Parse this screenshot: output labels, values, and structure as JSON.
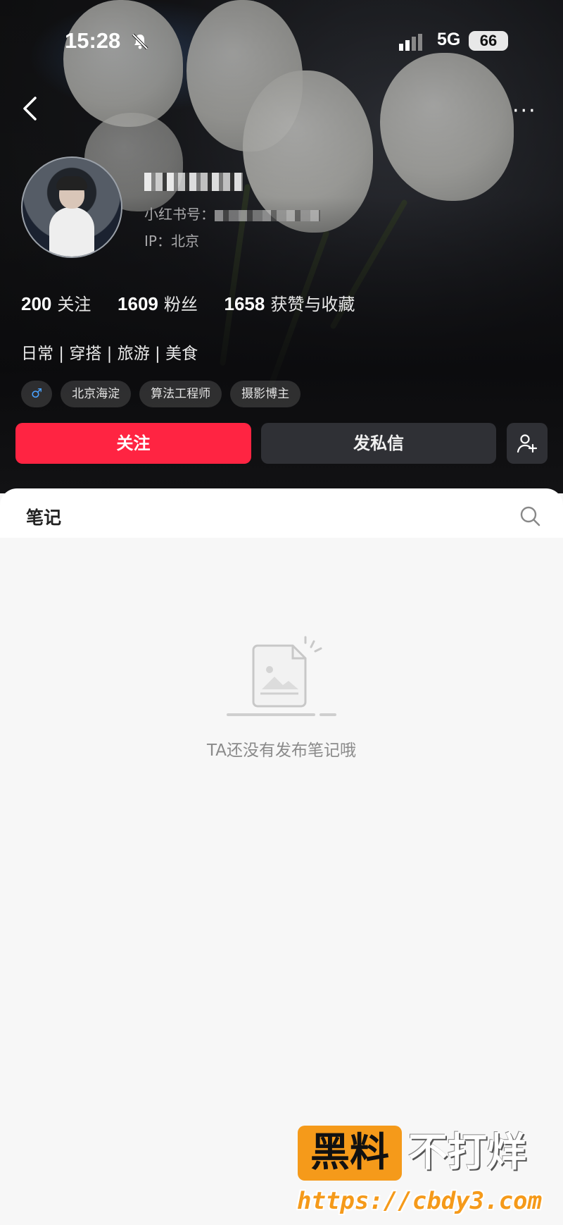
{
  "status_bar": {
    "time": "15:28",
    "network": "5G",
    "battery": "66"
  },
  "profile": {
    "red_id_label": "小红书号：",
    "ip_label": "IP：北京",
    "stats": [
      {
        "value": "200",
        "label": "关注"
      },
      {
        "value": "1609",
        "label": "粉丝"
      },
      {
        "value": "1658",
        "label": "获赞与收藏"
      }
    ],
    "bio": "日常 | 穿搭 | 旅游 | 美食",
    "gender_tag": "♂",
    "tags": [
      "北京海淀",
      "算法工程师",
      "摄影博主"
    ]
  },
  "actions": {
    "follow": "关注",
    "message": "发私信"
  },
  "notes": {
    "tab_label": "笔记",
    "empty_text": "TA还没有发布笔记哦"
  },
  "watermark": {
    "box": "黑料",
    "right": "不打烊",
    "url": "https://cbdy3.com"
  },
  "colors": {
    "accent": "#ff2442",
    "watermark": "#f59a1a"
  }
}
